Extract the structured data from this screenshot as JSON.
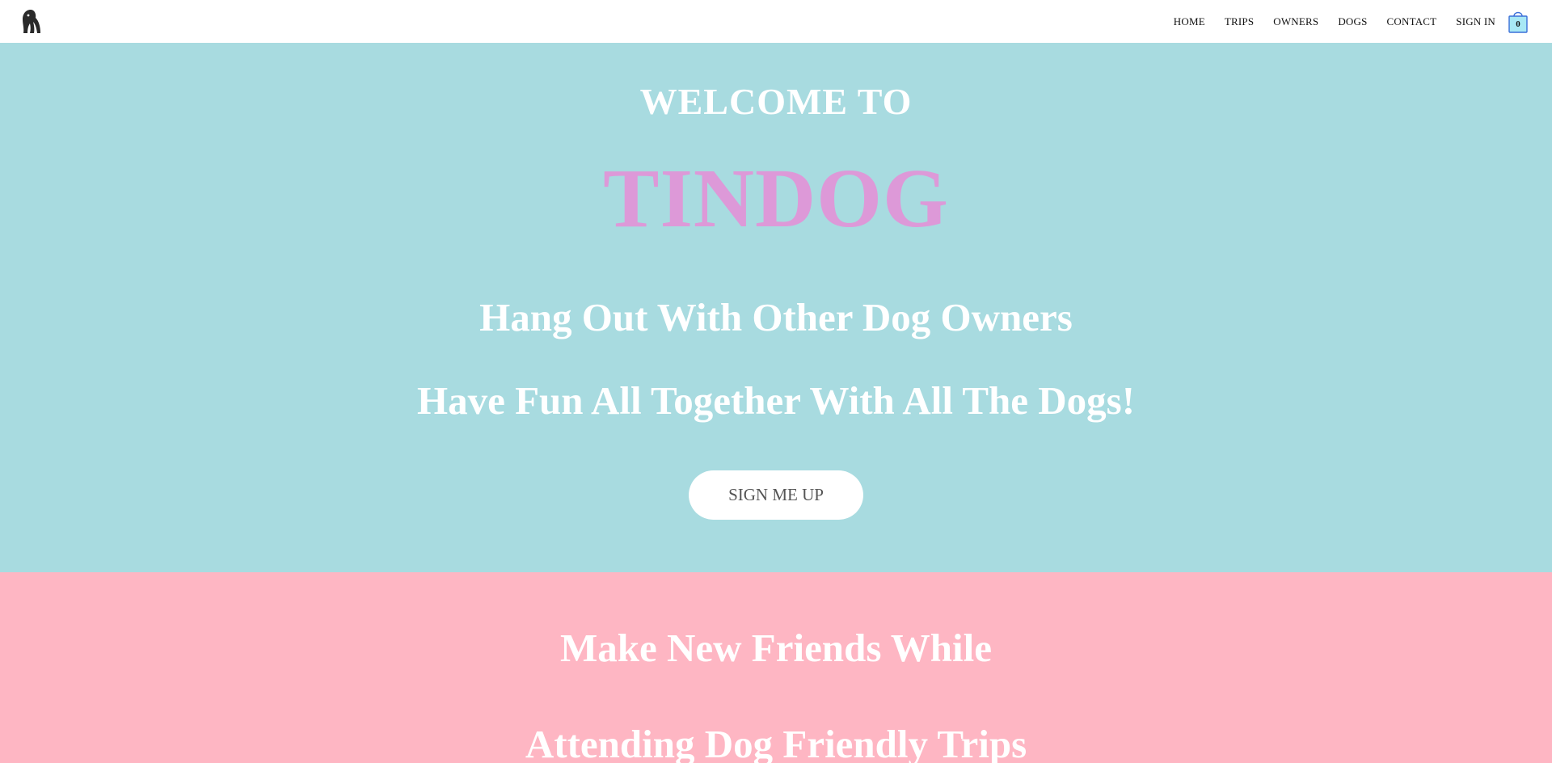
{
  "header": {
    "logo_icon": "dog-logo-icon",
    "nav": [
      {
        "label": "HOME"
      },
      {
        "label": "TRIPS"
      },
      {
        "label": "OWNERS"
      },
      {
        "label": "DOGS"
      },
      {
        "label": "CONTACT"
      },
      {
        "label": "SIGN IN"
      }
    ],
    "cart": {
      "icon": "shopping-bag-icon",
      "count": "0"
    }
  },
  "hero": {
    "welcome": "WELCOME TO",
    "brand": "TINDOG",
    "tagline_1": "Hang Out With Other Dog Owners",
    "tagline_2": "Have Fun All Together With All The Dogs!",
    "cta_label": "SIGN ME UP"
  },
  "features": {
    "line_1": "Make New Friends While",
    "line_2": "Attending Dog Friendly Trips"
  },
  "colors": {
    "hero_bg": "#a8dbe0",
    "brand": "#dd99d8",
    "features_bg": "#feb6c3",
    "cart_fill": "#a8e8f5"
  }
}
